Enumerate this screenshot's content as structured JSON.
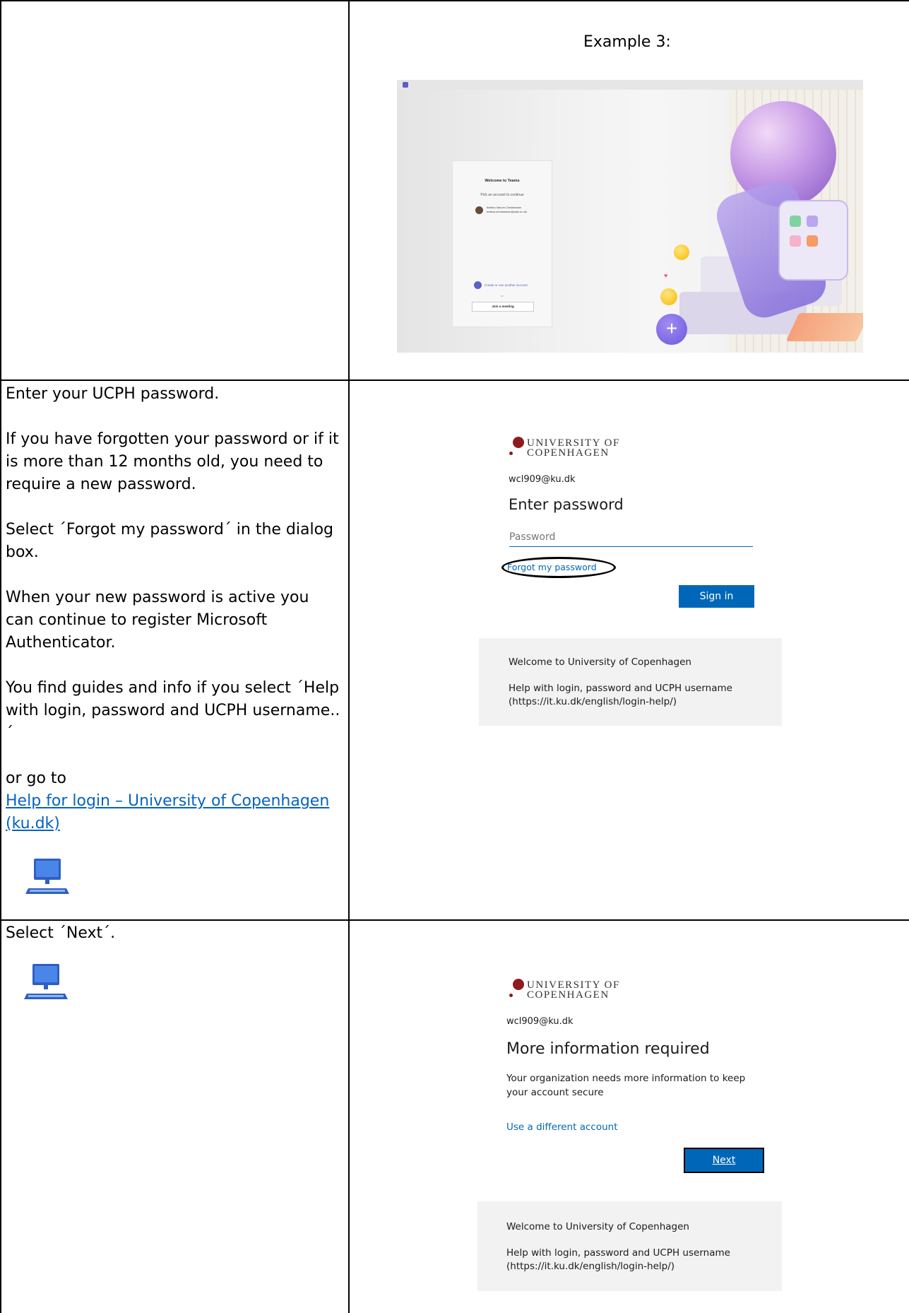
{
  "row1": {
    "example_title": "Example 3:",
    "teams": {
      "welcome": "Welcome to Teams",
      "pick": "Pick an account to continue",
      "account_name": "Bettina Vanum Christiansen",
      "account_email": "bettina.christiansen@adm.ku.dk",
      "create": "Create or use another account",
      "or": "or",
      "join": "Join a meeting"
    }
  },
  "row2": {
    "instructions": [
      "Enter your UCPH password.",
      "If you have forgotten your password or if it is more than 12 months old, you need to require a new password.",
      "Select ´Forgot my password´ in the dialog box.",
      "When your new password is active you can continue to register Microsoft Authenticator.",
      "You find guides and info if you select ´Help with login, password and UCPH username..´",
      "or go to"
    ],
    "help_link": "Help for login – University of Copenhagen (ku.dk)",
    "login": {
      "logo_line1": "UNIVERSITY OF",
      "logo_line2": "COPENHAGEN",
      "username": "wcl909@ku.dk",
      "title": "Enter password",
      "password_placeholder": "Password",
      "forgot": "Forgot my password",
      "sign_in": "Sign in",
      "footer_title": "Welcome to University of Copenhagen",
      "footer_help": "Help with login, password and UCPH username (https://it.ku.dk/english/login-help/)"
    }
  },
  "row3": {
    "instruction": "Select ´Next´.",
    "login": {
      "logo_line1": "UNIVERSITY OF",
      "logo_line2": "COPENHAGEN",
      "username": "wcl909@ku.dk",
      "title": "More information required",
      "body": "Your organization needs more information to keep your account secure",
      "different_account": "Use a different account",
      "next": "Next",
      "footer_title": "Welcome to University of Copenhagen",
      "footer_help": "Help with login, password and UCPH username (https://it.ku.dk/english/login-help/)"
    }
  },
  "colors": {
    "ku_red": "#901a1e",
    "ms_blue": "#0067b8",
    "link_blue": "#0563c1"
  },
  "icons": [
    "computer-icon"
  ]
}
